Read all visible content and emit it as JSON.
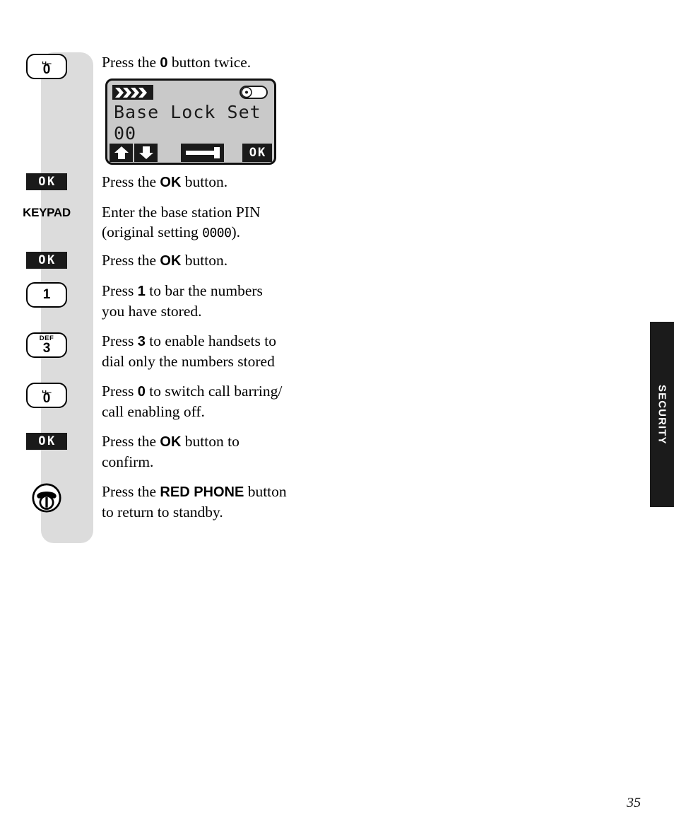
{
  "page": {
    "number": "35",
    "side_tab_label": "SECURITY"
  },
  "lcd": {
    "signal_icon": "signal-bars-icon",
    "battery_icon": "battery-icon",
    "line1": "Base Lock Set",
    "line2": "00",
    "softkeys": {
      "up": "up-arrow-icon",
      "down": "down-arrow-icon",
      "clear": "clear-bar-icon",
      "ok": "OK"
    }
  },
  "steps": [
    {
      "key": {
        "type": "keycap",
        "sup": "␣_",
        "digit": "0",
        "name": "key-0"
      },
      "text_html": "Press the <b>0</b> button twice.",
      "has_lcd": true
    },
    {
      "key": {
        "type": "okchip",
        "label": "OK",
        "name": "key-ok"
      },
      "text_html": "Press the <b>OK</b> button.",
      "has_lcd": false
    },
    {
      "key": {
        "type": "keypad-label",
        "label": "KEYPAD",
        "name": "key-keypad"
      },
      "text_html": "Enter the base station PIN<br>(original setting <span class=\"mono-pin\">0000</span>).",
      "has_lcd": false
    },
    {
      "key": {
        "type": "okchip",
        "label": "OK",
        "name": "key-ok"
      },
      "text_html": "Press the <b>OK</b> button.",
      "has_lcd": false
    },
    {
      "key": {
        "type": "keycap",
        "sup": "",
        "digit": "1",
        "name": "key-1"
      },
      "text_html": "Press <b>1</b> to bar the numbers<br>you have stored.",
      "has_lcd": false
    },
    {
      "key": {
        "type": "keycap",
        "sup": "DEF",
        "digit": "3",
        "name": "key-3"
      },
      "text_html": "Press <b>3</b> to enable handsets to<br>dial only the numbers stored",
      "has_lcd": false
    },
    {
      "key": {
        "type": "keycap",
        "sup": "␣_",
        "digit": "0",
        "name": "key-0"
      },
      "text_html": "Press <b>0</b> to switch call barring/<br>call enabling off.",
      "has_lcd": false
    },
    {
      "key": {
        "type": "okchip",
        "label": "OK",
        "name": "key-ok"
      },
      "text_html": "Press the <b>OK</b> button to<br>confirm.",
      "has_lcd": false
    },
    {
      "key": {
        "type": "redphone",
        "name": "key-red-phone"
      },
      "text_html": "Press the <b>RED PHONE</b> button<br>to return to standby.",
      "has_lcd": false
    }
  ]
}
